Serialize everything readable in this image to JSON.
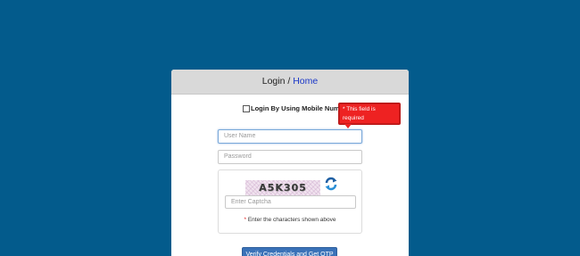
{
  "header": {
    "login_label": "Login",
    "separator": " / ",
    "home_link": "Home"
  },
  "mobile_option": {
    "label": "Login By Using Mobile Number"
  },
  "tooltip": {
    "star": "*",
    "text": " This field is required"
  },
  "fields": {
    "username_placeholder": "User Name",
    "password_placeholder": "Password",
    "captcha_placeholder": "Enter Captcha"
  },
  "captcha": {
    "code": "A5K305",
    "hint_star": "*",
    "hint_text": " Enter the characters shown above"
  },
  "actions": {
    "submit_label": "Verify Credentials and Get OTP"
  },
  "colors": {
    "background": "#035b8c",
    "tooltip": "#ee2222",
    "button": "#3a72b8",
    "link": "#1a37c8"
  }
}
